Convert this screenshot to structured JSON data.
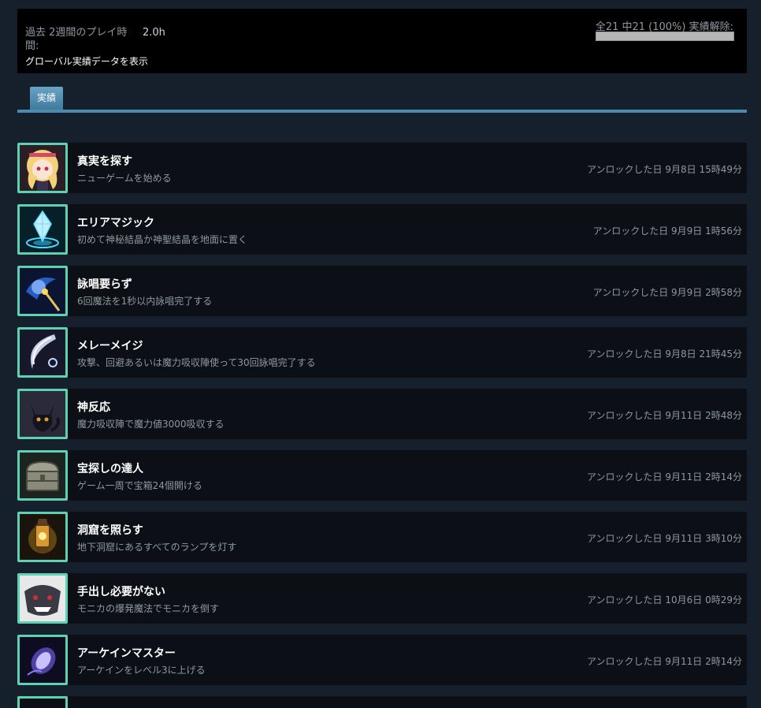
{
  "header": {
    "playtime_label": "過去 2週間のプレイ時間:",
    "playtime_value": "2.0h",
    "global_link": "グローバル実績データを表示",
    "progress_text": "全21 中21 (100%) 実績解除:",
    "progress_fraction": 1.0
  },
  "tabs": [
    {
      "label": "実績"
    }
  ],
  "achievements": [
    {
      "title": "真実を探す",
      "desc": "ニューゲームを始める",
      "unlock": "アンロックした日 9月8日 15時49分",
      "icon": "blonde-girl-icon"
    },
    {
      "title": "エリアマジック",
      "desc": "初めて神秘結晶か神聖結晶を地面に置く",
      "unlock": "アンロックした日 9月9日 1時56分",
      "icon": "crystal-icon"
    },
    {
      "title": "詠唱要らず",
      "desc": "6回魔法を1秒以内詠唱完了する",
      "unlock": "アンロックした日 9月9日 2時58分",
      "icon": "magic-staff-icon"
    },
    {
      "title": "メレーメイジ",
      "desc": "攻撃、回避あるいは魔力吸収陣使って30回詠唱完了する",
      "unlock": "アンロックした日 9月8日 21時45分",
      "icon": "slash-icon"
    },
    {
      "title": "神反応",
      "desc": "魔力吸収陣で魔力値3000吸収する",
      "unlock": "アンロックした日 9月11日 2時48分",
      "icon": "black-cat-icon"
    },
    {
      "title": "宝探しの達人",
      "desc": "ゲーム一周で宝箱24個開ける",
      "unlock": "アンロックした日 9月11日 2時14分",
      "icon": "treasure-chest-icon"
    },
    {
      "title": "洞窟を照らす",
      "desc": "地下洞窟にあるすべてのランプを灯す",
      "unlock": "アンロックした日 9月11日 3時10分",
      "icon": "lantern-icon"
    },
    {
      "title": "手出し必要がない",
      "desc": "モニカの爆発魔法でモニカを倒す",
      "unlock": "アンロックした日 10月6日 0時29分",
      "icon": "beast-icon"
    },
    {
      "title": "アーケインマスター",
      "desc": "アーケインをレベル3に上げる",
      "unlock": "アンロックした日 9月11日 2時14分",
      "icon": "arcane-orb-icon"
    }
  ]
}
